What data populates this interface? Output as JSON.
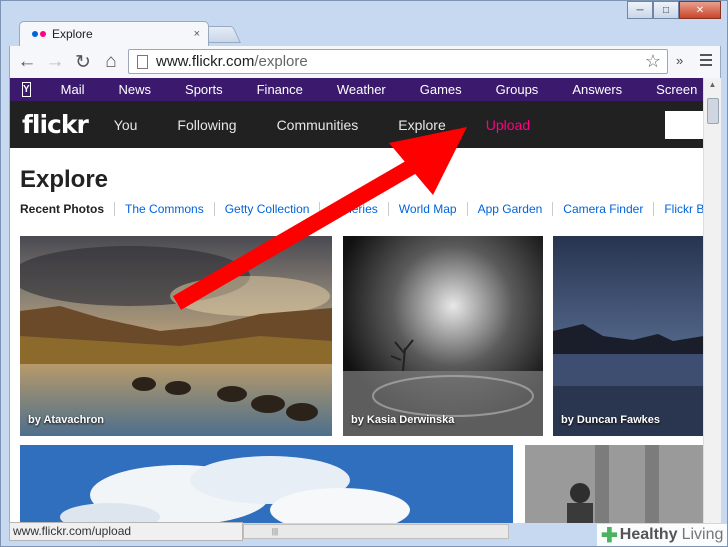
{
  "browser": {
    "tab_title": "Explore",
    "tab_close": "×",
    "url_domain": "www.flickr.com",
    "url_path": "/explore",
    "status_url": "www.flickr.com/upload",
    "ext_label": "»",
    "scroll_grip": "|||"
  },
  "window_controls": {
    "minimize": "─",
    "maximize": "□",
    "close": "✕"
  },
  "nav_glyphs": {
    "back": "←",
    "forward": "→",
    "reload": "↻",
    "home": "⌂",
    "star": "☆"
  },
  "yahoo_bar": {
    "logo": "Y",
    "items": [
      "Mail",
      "News",
      "Sports",
      "Finance",
      "Weather",
      "Games",
      "Groups",
      "Answers",
      "Screen"
    ]
  },
  "flickr": {
    "logo": "flickr",
    "nav": [
      "You",
      "Following",
      "Communities",
      "Explore",
      "Upload"
    ],
    "page_title": "Explore",
    "subnav": [
      "Recent Photos",
      "The Commons",
      "Getty Collection",
      "Galleries",
      "World Map",
      "App Garden",
      "Camera Finder",
      "Flickr Blog"
    ]
  },
  "photos": [
    {
      "caption": "by Atavachron"
    },
    {
      "caption": "by Kasia Derwinska"
    },
    {
      "caption": "by Duncan Fawkes"
    }
  ],
  "watermark": {
    "brand": "Healthy",
    "brand2": "Living"
  },
  "colors": {
    "yahoo_purple": "#3b1a6e",
    "flickr_pink": "#ff0084",
    "flickr_blue": "#0063dc",
    "arrow_red": "#ff0000"
  }
}
